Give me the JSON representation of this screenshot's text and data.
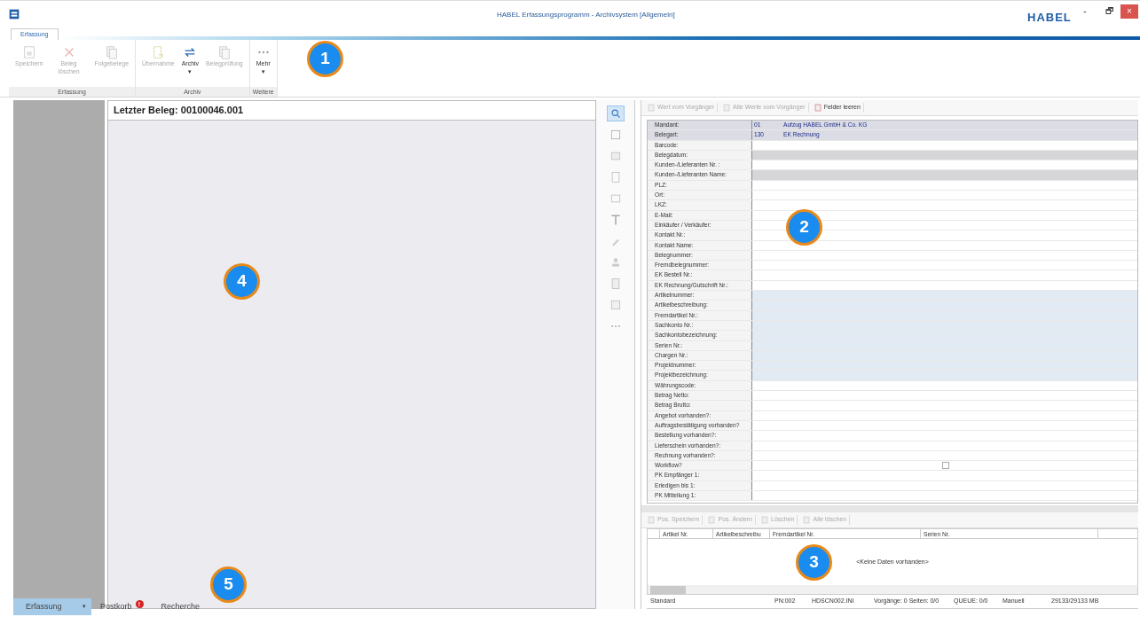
{
  "window": {
    "title": "HABEL Erfassungsprogramm - Archivsystem [Allgemein]",
    "logo": "HABEL",
    "controls": [
      "-",
      "🗗",
      "×"
    ]
  },
  "ribbon_tab": {
    "label": "Erfassung",
    "selected": true
  },
  "ribbon_groups": [
    {
      "label": "Erfassung",
      "buttons": [
        {
          "label": "Speichern",
          "disabled": true
        },
        {
          "label": "Beleg löschen",
          "disabled": true
        },
        {
          "label": "Folgebelege",
          "disabled": true
        }
      ]
    },
    {
      "label": "Archiv",
      "buttons": [
        {
          "label": "Übernahme",
          "disabled": true
        },
        {
          "label": "Archiv",
          "disabled": false,
          "dropdown": "▾"
        },
        {
          "label": "Belegprüfung",
          "disabled": true
        }
      ]
    },
    {
      "label": "Weitere",
      "buttons": [
        {
          "label": "Mehr",
          "disabled": false,
          "dropdown": "▾"
        }
      ]
    }
  ],
  "document": {
    "header": "Letzter Beleg: 00100046.001"
  },
  "viewer_tools": [
    {
      "selected": true
    },
    {
      "selected": false
    },
    {
      "selected": false
    },
    {
      "selected": false
    },
    {
      "selected": false
    },
    {
      "selected": false
    },
    {
      "selected": false
    },
    {
      "selected": false
    },
    {
      "selected": false
    },
    {
      "selected": false
    },
    {
      "selected": false
    }
  ],
  "field_toolbar": [
    {
      "label": "Wert vom Vorgänger",
      "disabled": true
    },
    {
      "label": "Alle Werte vom Vorgänger",
      "disabled": true
    },
    {
      "label": "Felder leeren",
      "disabled": false
    }
  ],
  "fields": [
    {
      "label": "Mandant:",
      "kind": "header",
      "code": "01",
      "value": "Aufzug HABEL GmbH & Co. KG"
    },
    {
      "label": "Belegart:",
      "kind": "header",
      "code": "130",
      "value": "EK Rechnung"
    },
    {
      "label": "Barcode:",
      "kind": "plain"
    },
    {
      "label": "Belegdatum:",
      "kind": "gray"
    },
    {
      "label": "Kunden-/Lieferanten Nr. :",
      "kind": "plain"
    },
    {
      "label": "Kunden-/Lieferanten Name:",
      "kind": "gray"
    },
    {
      "label": "PLZ:",
      "kind": "plain"
    },
    {
      "label": "Ort:",
      "kind": "plain"
    },
    {
      "label": "LKZ:",
      "kind": "plain"
    },
    {
      "label": "E-Mail:",
      "kind": "plain"
    },
    {
      "label": "Einkäufer / Verkäufer:",
      "kind": "plain"
    },
    {
      "label": "Kontakt Nr.:",
      "kind": "plain"
    },
    {
      "label": "Kontakt Name:",
      "kind": "plain"
    },
    {
      "label": "Belegnummer:",
      "kind": "plain"
    },
    {
      "label": "Fremdbelegnummer:",
      "kind": "plain"
    },
    {
      "label": "EK Bestell Nr.:",
      "kind": "plain"
    },
    {
      "label": "EK Rechnung/Gutschrift Nr.:",
      "kind": "plain"
    },
    {
      "label": "Artikelnummer:",
      "kind": "blue"
    },
    {
      "label": "Artikelbeschreibung:",
      "kind": "blue"
    },
    {
      "label": "Fremdartikel Nr.:",
      "kind": "blue"
    },
    {
      "label": "Sachkonto Nr.:",
      "kind": "blue"
    },
    {
      "label": "Sachkontobezeichnung:",
      "kind": "blue"
    },
    {
      "label": "Serien Nr.:",
      "kind": "blue"
    },
    {
      "label": "Chargen Nr.:",
      "kind": "blue"
    },
    {
      "label": "Projektnummer:",
      "kind": "blue"
    },
    {
      "label": "Projektbezeichnung:",
      "kind": "blue"
    },
    {
      "label": "Währungscode:",
      "kind": "plain"
    },
    {
      "label": "Betrag Netto:",
      "kind": "plain"
    },
    {
      "label": "Betrag Brutto:",
      "kind": "plain"
    },
    {
      "label": "Angebot vorhanden?:",
      "kind": "plain"
    },
    {
      "label": "Auftragsbestätigung vorhanden?",
      "kind": "plain"
    },
    {
      "label": "Bestellung vorhanden?:",
      "kind": "plain"
    },
    {
      "label": "Lieferschein vorhanden?:",
      "kind": "plain"
    },
    {
      "label": "Rechnung vorhanden?:",
      "kind": "plain"
    },
    {
      "label": "Workflow?",
      "kind": "check",
      "checked": false
    },
    {
      "label": "PK Empfänger 1:",
      "kind": "plain"
    },
    {
      "label": "Erledigen bis 1:",
      "kind": "plain"
    },
    {
      "label": "PK Mitteilung 1:",
      "kind": "plain"
    }
  ],
  "position_toolbar": [
    {
      "label": "Pos. Speichern",
      "disabled": true
    },
    {
      "label": "Pos. Ändern",
      "disabled": true
    },
    {
      "label": "Löschen",
      "disabled": true
    },
    {
      "label": "Alle löschen",
      "disabled": true
    }
  ],
  "positions_table": {
    "columns": [
      "Artikel Nr.",
      "Artikelbeschreibu",
      "Fremdartikel Nr.",
      "Serien Nr."
    ],
    "empty_text": "<Keine Daten vorhanden>"
  },
  "status_bar": [
    "Standard",
    "PN:002",
    "HDSCN002.INI",
    "Vorgänge: 0 Seiten: 0/0",
    "QUEUE: 0/0",
    "Manuell",
    "29133/29133 MB"
  ],
  "bottom_tabs": [
    {
      "label": "Erfassung",
      "selected": true,
      "dropdown": "▾"
    },
    {
      "label": "Postkorb",
      "selected": false,
      "alert": "!"
    },
    {
      "label": "Recherche",
      "selected": false
    }
  ],
  "callouts": [
    "1",
    "2",
    "3",
    "4",
    "5"
  ]
}
